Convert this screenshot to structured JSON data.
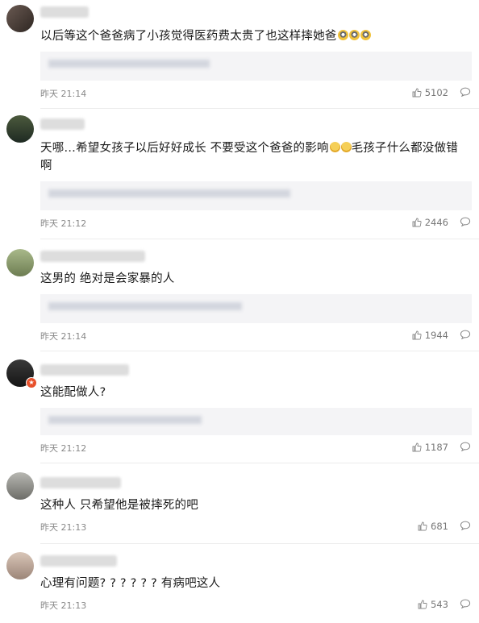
{
  "colors": {
    "background": "#ffffff",
    "reply_bg": "#f4f4f6",
    "divider": "#ececec",
    "meta_text": "#888888"
  },
  "icons": {
    "like": "thumb-up-icon",
    "comment": "comment-bubble-icon"
  },
  "comments": [
    {
      "username": "",
      "text": "以后等这个爸爸病了小孩觉得医药费太贵了也这样摔她爸",
      "reply_preview": "",
      "time": "昨天 21:14",
      "likes": "5102"
    },
    {
      "username": "",
      "text": "天哪…希望女孩子以后好好成长 不要受这个爸爸的影响",
      "text_after_emoji": "毛孩子什么都没做错啊",
      "reply_preview": "",
      "time": "昨天 21:12",
      "likes": "2446"
    },
    {
      "username": "",
      "text": "这男的 绝对是会家暴的人",
      "reply_preview": "",
      "time": "昨天 21:14",
      "likes": "1944"
    },
    {
      "username": "",
      "text": "这能配做人?",
      "reply_preview": "",
      "time": "昨天 21:12",
      "likes": "1187"
    },
    {
      "username": "",
      "text": "这种人 只希望他是被摔死的吧",
      "time": "昨天 21:13",
      "likes": "681"
    },
    {
      "username": "",
      "text": "心理有问题? ? ? ? ? ? 有病吧这人",
      "time": "昨天 21:13",
      "likes": "543"
    }
  ]
}
